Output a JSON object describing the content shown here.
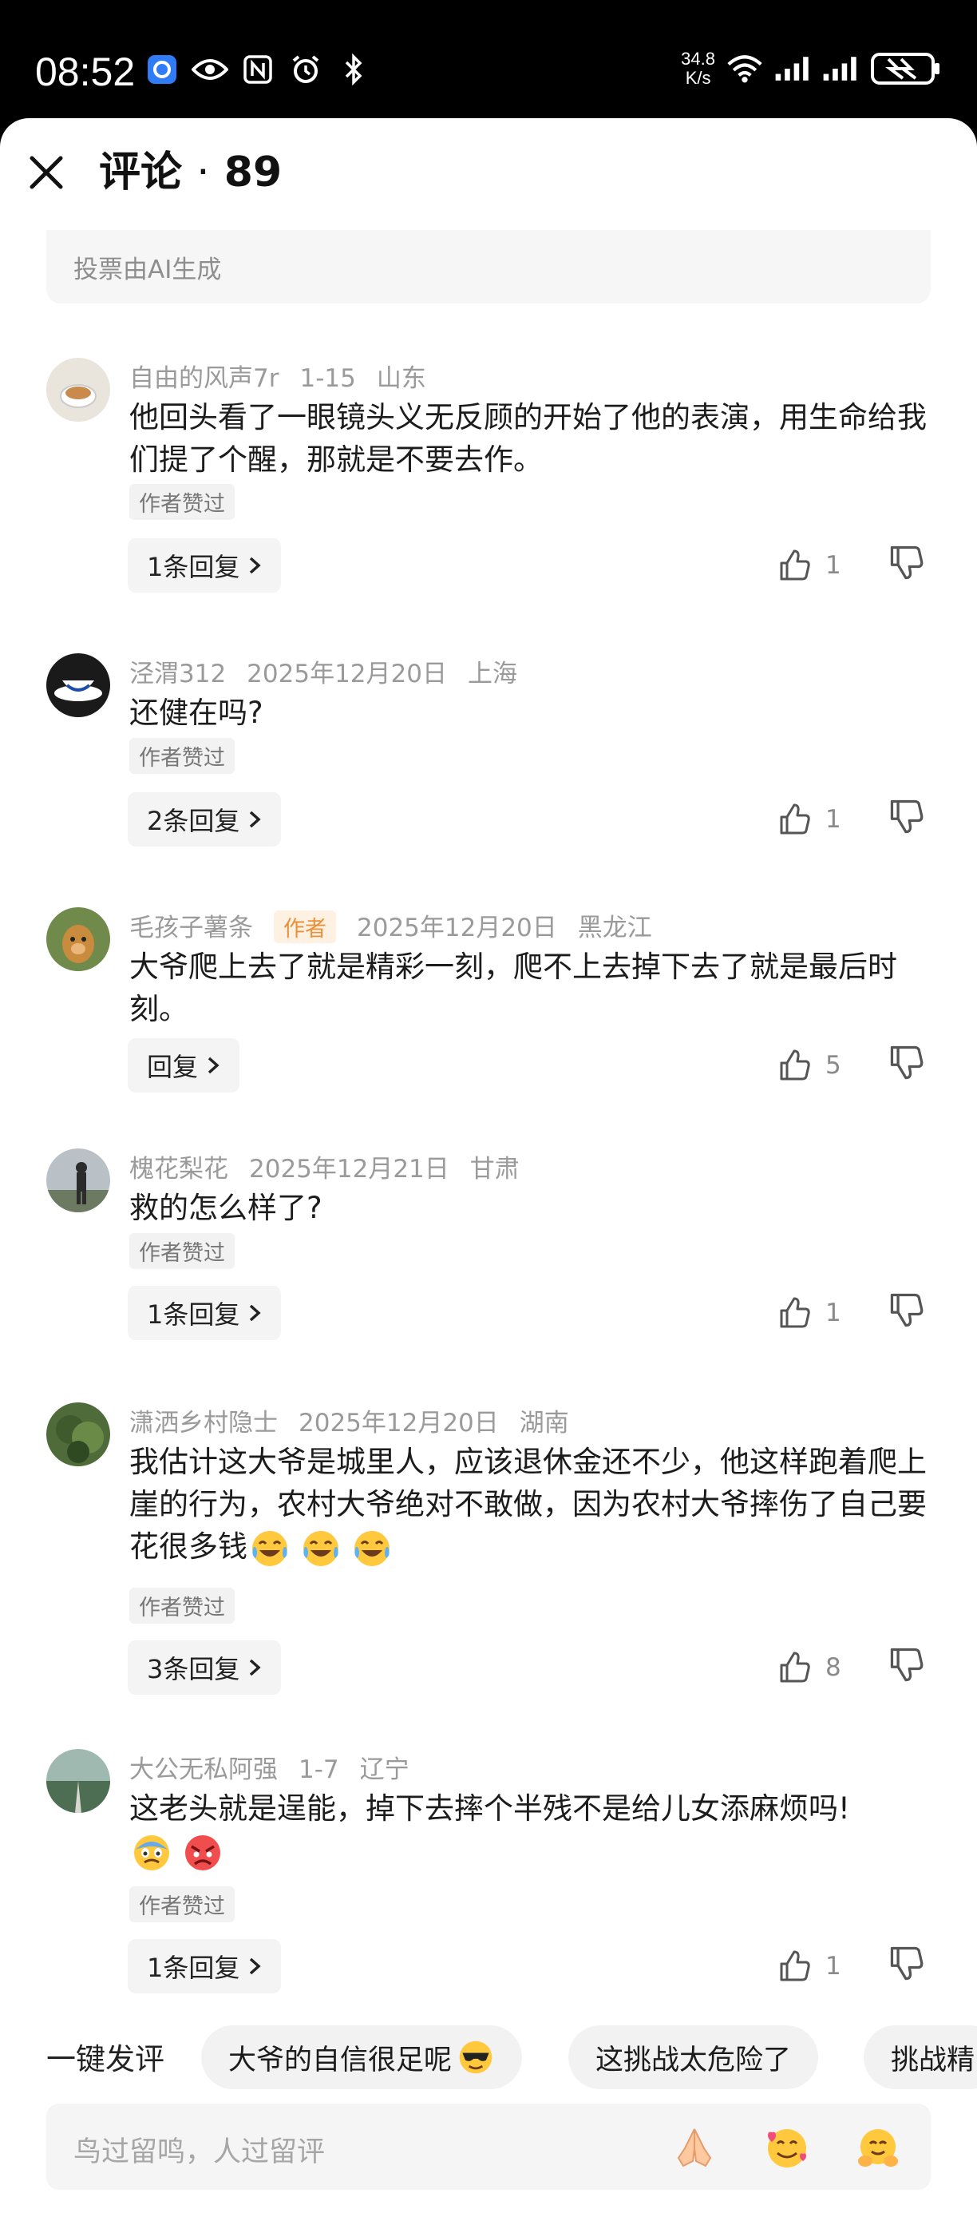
{
  "status_bar": {
    "time": "08:52",
    "net_speed_value": "34.8",
    "net_speed_unit": "K/s"
  },
  "header": {
    "title": "评论",
    "separator": "·",
    "count": "89"
  },
  "vote_note": "投票由AI生成",
  "comments": [
    {
      "user": "自由的风声7r",
      "date": "1-15",
      "location": "山东",
      "text": "他回头看了一眼镜头义无反顾的开始了他的表演，用生命给我们提了个醒，那就是不要去作。",
      "liked_tag": "作者赞过",
      "reply": "1条回复",
      "likes": "1"
    },
    {
      "user": "泾渭312",
      "date": "2025年12月20日",
      "location": "上海",
      "text": "还健在吗?",
      "liked_tag": "作者赞过",
      "reply": "2条回复",
      "likes": "1"
    },
    {
      "user": "毛孩子薯条",
      "author_tag": "作者",
      "date": "2025年12月20日",
      "location": "黑龙江",
      "text": "大爷爬上去了就是精彩一刻，爬不上去掉下去了就是最后时刻。",
      "reply": "回复",
      "likes": "5"
    },
    {
      "user": "槐花梨花",
      "date": "2025年12月21日",
      "location": "甘肃",
      "text": "救的怎么样了?",
      "liked_tag": "作者赞过",
      "reply": "1条回复",
      "likes": "1"
    },
    {
      "user": "潇洒乡村隐士",
      "date": "2025年12月20日",
      "location": "湖南",
      "text": "我估计这大爷是城里人，应该退休金还不少，他这样跑着爬上崖的行为，农村大爷绝对不敢做，因为农村大爷摔伤了自己要花很多钱",
      "liked_tag": "作者赞过",
      "reply": "3条回复",
      "likes": "8"
    },
    {
      "user": "大公无私阿强",
      "date": "1-7",
      "location": "辽宁",
      "text": "这老头就是逞能，掉下去摔个半残不是给儿女添麻烦吗!",
      "liked_tag": "作者赞过",
      "reply": "1条回复",
      "likes": "1"
    }
  ],
  "quick_comment": {
    "label": "一键发评",
    "chips": [
      "大爷的自信很足呢",
      "这挑战太危险了",
      "挑战精"
    ]
  },
  "input": {
    "placeholder": "鸟过留鸣，人过留评"
  },
  "colors": {
    "accent_author": "#e8913a",
    "muted": "#9a9a9a",
    "chip_bg": "#f2f2f2"
  }
}
